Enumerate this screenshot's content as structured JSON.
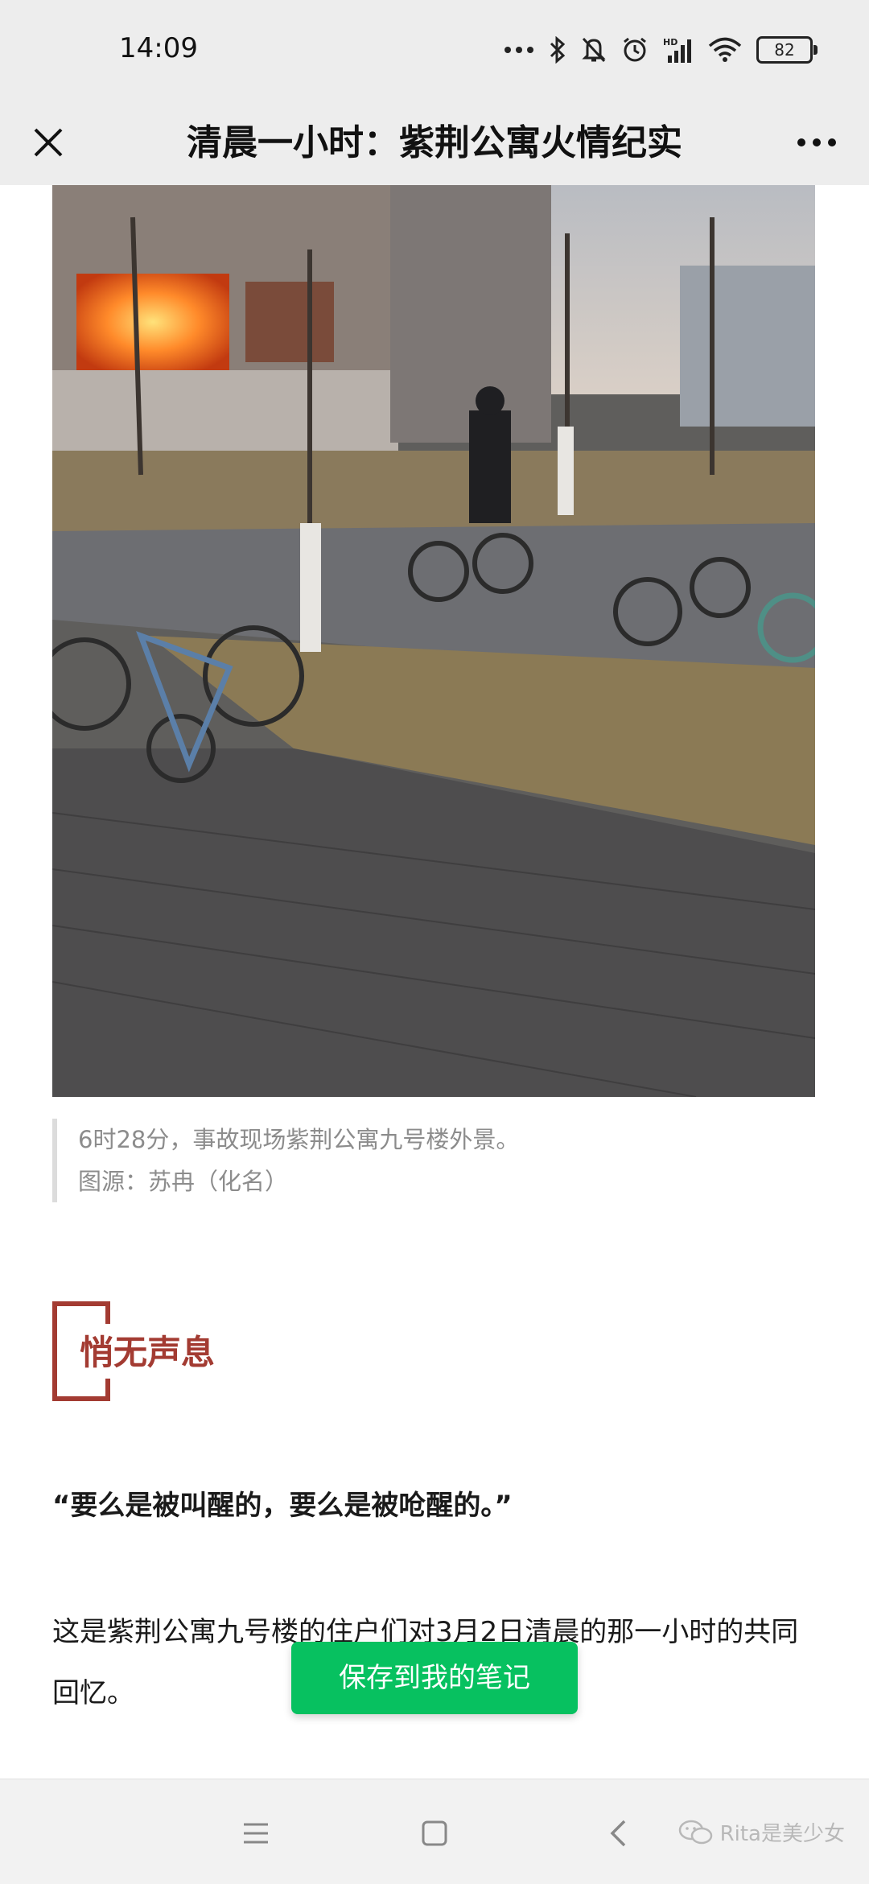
{
  "status_bar": {
    "time": "14:09",
    "battery": "82",
    "icons": [
      "more-dots-icon",
      "bluetooth-icon",
      "mute-bell-icon",
      "alarm-icon",
      "hd-signal-icon",
      "wifi-icon",
      "battery-icon"
    ]
  },
  "nav": {
    "title": "清晨一小时：紫荆公寓火情纪实",
    "close_icon": "close-icon",
    "more_icon": "more-icon"
  },
  "article": {
    "caption_line1": "6时28分，事故现场紫荆公寓九号楼外景。",
    "caption_line2": "图源：苏冉（化名）",
    "section_title": "悄无声息",
    "quote": "“要么是被叫醒的，要么是被呛醒的。”",
    "paragraph": "这是紫荆公寓九号楼的住户们对3月2日清晨的那一小时的共同回忆。"
  },
  "save_button": {
    "label": "保存到我的笔记"
  },
  "system_nav": {
    "icons": [
      "menu-icon",
      "home-icon",
      "back-icon"
    ]
  },
  "watermark": {
    "text": "Rita是美少女"
  },
  "colors": {
    "accent_green": "#07c160",
    "section_red": "#a33b32",
    "header_bg": "#ededed"
  }
}
